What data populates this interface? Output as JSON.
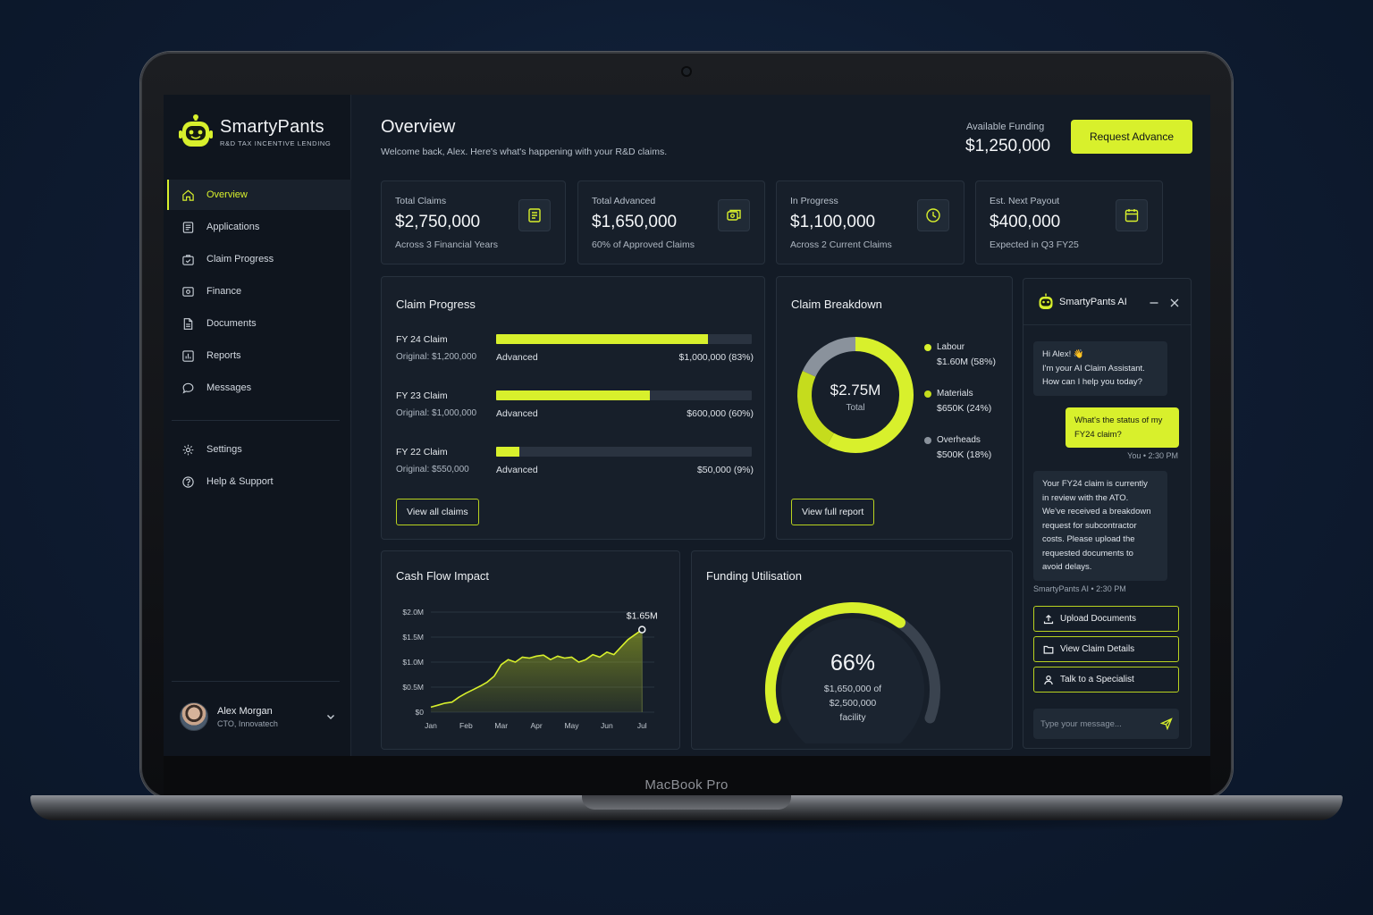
{
  "device_label": "MacBook Pro",
  "brand": {
    "name": "SmartyPants",
    "tagline": "R&D TAX INCENTIVE LENDING"
  },
  "sidebar": {
    "items": [
      {
        "label": "Overview",
        "icon": "home-icon",
        "active": true
      },
      {
        "label": "Applications",
        "icon": "document-list-icon"
      },
      {
        "label": "Claim Progress",
        "icon": "briefcase-check-icon"
      },
      {
        "label": "Finance",
        "icon": "money-icon"
      },
      {
        "label": "Documents",
        "icon": "file-icon"
      },
      {
        "label": "Reports",
        "icon": "chart-box-icon"
      },
      {
        "label": "Messages",
        "icon": "message-bubble-icon"
      }
    ],
    "secondary": [
      {
        "label": "Settings",
        "icon": "gear-icon"
      },
      {
        "label": "Help & Support",
        "icon": "help-circle-icon"
      }
    ]
  },
  "user": {
    "name": "Alex Morgan",
    "role": "CTO, Innovatech"
  },
  "header": {
    "title": "Overview",
    "subtitle": "Welcome back, Alex. Here's what's happening with your R&D claims.",
    "funding_label": "Available Funding",
    "funding_value": "$1,250,000",
    "request_button": "Request Advance"
  },
  "stats": [
    {
      "label": "Total Claims",
      "value": "$2,750,000",
      "sub": "Across 3 Financial Years",
      "icon": "document-icon"
    },
    {
      "label": "Total Advanced",
      "value": "$1,650,000",
      "sub": "60% of Approved Claims",
      "icon": "cash-icon"
    },
    {
      "label": "In Progress",
      "value": "$1,100,000",
      "sub": "Across 2 Current Claims",
      "icon": "clock-icon"
    },
    {
      "label": "Est. Next Payout",
      "value": "$400,000",
      "sub": "Expected in Q3 FY25",
      "icon": "calendar-icon"
    }
  ],
  "claim_progress": {
    "title": "Claim Progress",
    "claims": [
      {
        "name": "FY 24 Claim",
        "original": "Original: $1,200,000",
        "status": "Advanced",
        "amount": "$1,000,000 (83%)",
        "fraction": 0.83
      },
      {
        "name": "FY 23 Claim",
        "original": "Original: $1,000,000",
        "status": "Advanced",
        "amount": "$600,000 (60%)",
        "fraction": 0.6
      },
      {
        "name": "FY 22 Claim",
        "original": "Original: $550,000",
        "status": "Advanced",
        "amount": "$50,000 (9%)",
        "fraction": 0.09
      }
    ],
    "button": "View all claims"
  },
  "claim_breakdown": {
    "title": "Claim Breakdown",
    "center_value": "$2.75M",
    "center_label": "Total",
    "button": "View full report",
    "colors": {
      "Labour": "#d8f02c",
      "Materials": "#c5dc1d",
      "Overheads": "#8a929c"
    }
  },
  "cash_flow": {
    "title": "Cash Flow Impact",
    "peak_label": "$1.65M"
  },
  "funding_utilisation": {
    "title": "Funding Utilisation",
    "percent_label": "66%",
    "line1": "$1,650,000 of",
    "line2": "$2,500,000",
    "line3": "facility",
    "fraction": 0.66
  },
  "chat": {
    "title": "SmartyPants AI",
    "messages": [
      {
        "from": "ai",
        "lines": [
          "Hi Alex! 👋",
          "I'm your AI Claim Assistant.",
          "How can I help you today?"
        ]
      },
      {
        "from": "me",
        "lines": [
          "What's the status of my",
          "FY24 claim?"
        ],
        "meta": "You • 2:30 PM"
      },
      {
        "from": "ai",
        "lines": [
          "Your FY24 claim is currently",
          "in review with the ATO.",
          "We've received a breakdown",
          "request for subcontractor",
          "costs. Please upload the",
          "requested documents to",
          "avoid delays."
        ],
        "meta": "SmartyPants AI • 2:30 PM"
      }
    ],
    "actions": [
      {
        "label": "Upload Documents",
        "icon": "upload-icon"
      },
      {
        "label": "View Claim Details",
        "icon": "folder-icon"
      },
      {
        "label": "Talk to a Specialist",
        "icon": "person-icon"
      }
    ],
    "input_placeholder": "Type your message..."
  },
  "chart_data": [
    {
      "type": "pie",
      "title": "Claim Breakdown",
      "categories": [
        "Labour",
        "Materials",
        "Overheads"
      ],
      "values": [
        1.6,
        0.65,
        0.5
      ],
      "value_labels": [
        "$1.60M (58%)",
        "$650K (24%)",
        "$500K (18%)"
      ],
      "percents": [
        58,
        24,
        18
      ],
      "legend": "right"
    },
    {
      "type": "area",
      "title": "Cash Flow Impact",
      "categories": [
        "Jan",
        "Feb",
        "Mar",
        "Apr",
        "May",
        "Jun",
        "Jul"
      ],
      "ytick_labels": [
        "$2.0M",
        "$1.5M",
        "$1.0M",
        "$0.5M",
        "$0"
      ],
      "ylim": [
        0,
        2.0
      ],
      "x": [
        0,
        0.2,
        0.4,
        0.6,
        0.8,
        1.0,
        1.2,
        1.4,
        1.6,
        1.8,
        2.0,
        2.2,
        2.4,
        2.6,
        2.8,
        3.0,
        3.2,
        3.4,
        3.6,
        3.8,
        4.0,
        4.2,
        4.4,
        4.6,
        4.8,
        5.0,
        5.2,
        5.4,
        5.6,
        5.8,
        6.0
      ],
      "values": [
        0.1,
        0.14,
        0.18,
        0.2,
        0.3,
        0.38,
        0.45,
        0.52,
        0.6,
        0.72,
        0.95,
        1.05,
        1.0,
        1.1,
        1.08,
        1.12,
        1.14,
        1.05,
        1.12,
        1.08,
        1.1,
        1.0,
        1.05,
        1.15,
        1.1,
        1.2,
        1.15,
        1.3,
        1.45,
        1.55,
        1.65
      ],
      "peak_label": "$1.65M",
      "grid": true
    }
  ]
}
